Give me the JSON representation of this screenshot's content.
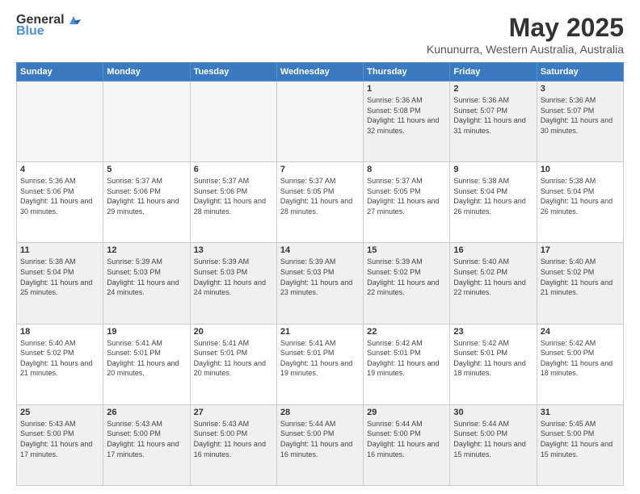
{
  "logo": {
    "general": "General",
    "blue": "Blue"
  },
  "title": "May 2025",
  "location": "Kununurra, Western Australia, Australia",
  "weekdays": [
    "Sunday",
    "Monday",
    "Tuesday",
    "Wednesday",
    "Thursday",
    "Friday",
    "Saturday"
  ],
  "weeks": [
    [
      {
        "day": "",
        "info": ""
      },
      {
        "day": "",
        "info": ""
      },
      {
        "day": "",
        "info": ""
      },
      {
        "day": "",
        "info": ""
      },
      {
        "day": "1",
        "info": "Sunrise: 5:36 AM\nSunset: 5:08 PM\nDaylight: 11 hours\nand 32 minutes."
      },
      {
        "day": "2",
        "info": "Sunrise: 5:36 AM\nSunset: 5:07 PM\nDaylight: 11 hours\nand 31 minutes."
      },
      {
        "day": "3",
        "info": "Sunrise: 5:36 AM\nSunset: 5:07 PM\nDaylight: 11 hours\nand 30 minutes."
      }
    ],
    [
      {
        "day": "4",
        "info": "Sunrise: 5:36 AM\nSunset: 5:06 PM\nDaylight: 11 hours\nand 30 minutes."
      },
      {
        "day": "5",
        "info": "Sunrise: 5:37 AM\nSunset: 5:06 PM\nDaylight: 11 hours\nand 29 minutes."
      },
      {
        "day": "6",
        "info": "Sunrise: 5:37 AM\nSunset: 5:06 PM\nDaylight: 11 hours\nand 28 minutes."
      },
      {
        "day": "7",
        "info": "Sunrise: 5:37 AM\nSunset: 5:05 PM\nDaylight: 11 hours\nand 28 minutes."
      },
      {
        "day": "8",
        "info": "Sunrise: 5:37 AM\nSunset: 5:05 PM\nDaylight: 11 hours\nand 27 minutes."
      },
      {
        "day": "9",
        "info": "Sunrise: 5:38 AM\nSunset: 5:04 PM\nDaylight: 11 hours\nand 26 minutes."
      },
      {
        "day": "10",
        "info": "Sunrise: 5:38 AM\nSunset: 5:04 PM\nDaylight: 11 hours\nand 26 minutes."
      }
    ],
    [
      {
        "day": "11",
        "info": "Sunrise: 5:38 AM\nSunset: 5:04 PM\nDaylight: 11 hours\nand 25 minutes."
      },
      {
        "day": "12",
        "info": "Sunrise: 5:39 AM\nSunset: 5:03 PM\nDaylight: 11 hours\nand 24 minutes."
      },
      {
        "day": "13",
        "info": "Sunrise: 5:39 AM\nSunset: 5:03 PM\nDaylight: 11 hours\nand 24 minutes."
      },
      {
        "day": "14",
        "info": "Sunrise: 5:39 AM\nSunset: 5:03 PM\nDaylight: 11 hours\nand 23 minutes."
      },
      {
        "day": "15",
        "info": "Sunrise: 5:39 AM\nSunset: 5:02 PM\nDaylight: 11 hours\nand 22 minutes."
      },
      {
        "day": "16",
        "info": "Sunrise: 5:40 AM\nSunset: 5:02 PM\nDaylight: 11 hours\nand 22 minutes."
      },
      {
        "day": "17",
        "info": "Sunrise: 5:40 AM\nSunset: 5:02 PM\nDaylight: 11 hours\nand 21 minutes."
      }
    ],
    [
      {
        "day": "18",
        "info": "Sunrise: 5:40 AM\nSunset: 5:02 PM\nDaylight: 11 hours\nand 21 minutes."
      },
      {
        "day": "19",
        "info": "Sunrise: 5:41 AM\nSunset: 5:01 PM\nDaylight: 11 hours\nand 20 minutes."
      },
      {
        "day": "20",
        "info": "Sunrise: 5:41 AM\nSunset: 5:01 PM\nDaylight: 11 hours\nand 20 minutes."
      },
      {
        "day": "21",
        "info": "Sunrise: 5:41 AM\nSunset: 5:01 PM\nDaylight: 11 hours\nand 19 minutes."
      },
      {
        "day": "22",
        "info": "Sunrise: 5:42 AM\nSunset: 5:01 PM\nDaylight: 11 hours\nand 19 minutes."
      },
      {
        "day": "23",
        "info": "Sunrise: 5:42 AM\nSunset: 5:01 PM\nDaylight: 11 hours\nand 18 minutes."
      },
      {
        "day": "24",
        "info": "Sunrise: 5:42 AM\nSunset: 5:00 PM\nDaylight: 11 hours\nand 18 minutes."
      }
    ],
    [
      {
        "day": "25",
        "info": "Sunrise: 5:43 AM\nSunset: 5:00 PM\nDaylight: 11 hours\nand 17 minutes."
      },
      {
        "day": "26",
        "info": "Sunrise: 5:43 AM\nSunset: 5:00 PM\nDaylight: 11 hours\nand 17 minutes."
      },
      {
        "day": "27",
        "info": "Sunrise: 5:43 AM\nSunset: 5:00 PM\nDaylight: 11 hours\nand 16 minutes."
      },
      {
        "day": "28",
        "info": "Sunrise: 5:44 AM\nSunset: 5:00 PM\nDaylight: 11 hours\nand 16 minutes."
      },
      {
        "day": "29",
        "info": "Sunrise: 5:44 AM\nSunset: 5:00 PM\nDaylight: 11 hours\nand 16 minutes."
      },
      {
        "day": "30",
        "info": "Sunrise: 5:44 AM\nSunset: 5:00 PM\nDaylight: 11 hours\nand 15 minutes."
      },
      {
        "day": "31",
        "info": "Sunrise: 5:45 AM\nSunset: 5:00 PM\nDaylight: 11 hours\nand 15 minutes."
      }
    ]
  ]
}
